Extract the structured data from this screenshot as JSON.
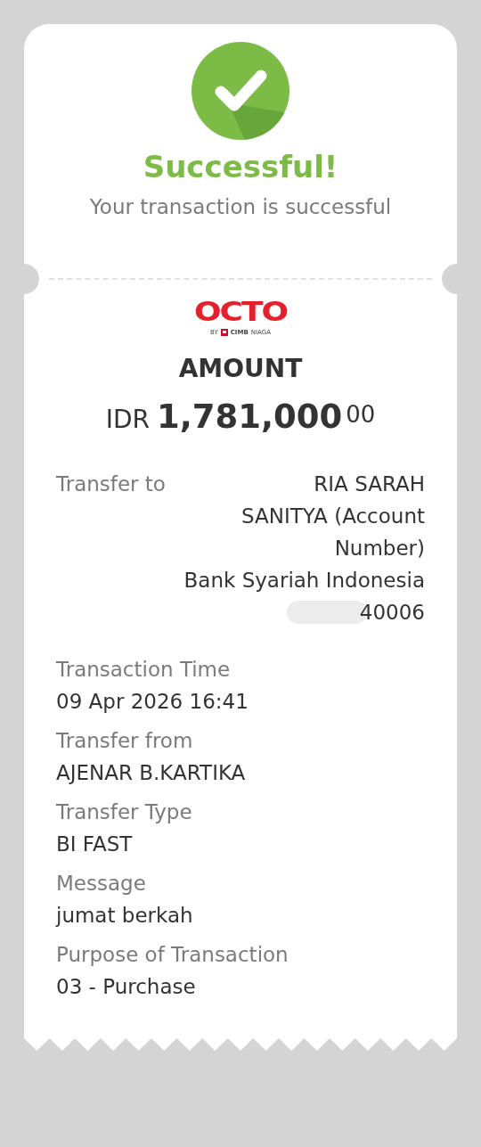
{
  "status": {
    "title": "Successful!",
    "subtitle": "Your transaction is successful"
  },
  "brand": {
    "logo": "OCTO",
    "byline_prefix": "BY",
    "byline_bank": "CIMB",
    "byline_suffix": "NIAGA"
  },
  "amount": {
    "label": "AMOUNT",
    "currency": "IDR",
    "value": "1,781,000",
    "decimals": "00"
  },
  "transfer_to": {
    "label": "Transfer to",
    "name": "RIA SARAH SANITYA (Account Number)",
    "bank": "Bank Syariah Indonesia",
    "account": "40006"
  },
  "details": [
    {
      "label": "Transaction Time",
      "value": "09 Apr 2026 16:41"
    },
    {
      "label": "Transfer from",
      "value": "AJENAR B.KARTIKA"
    },
    {
      "label": "Transfer Type",
      "value": "BI FAST"
    },
    {
      "label": "Message",
      "value": "jumat berkah"
    },
    {
      "label": "Purpose of Transaction",
      "value": "03 - Purchase"
    }
  ]
}
